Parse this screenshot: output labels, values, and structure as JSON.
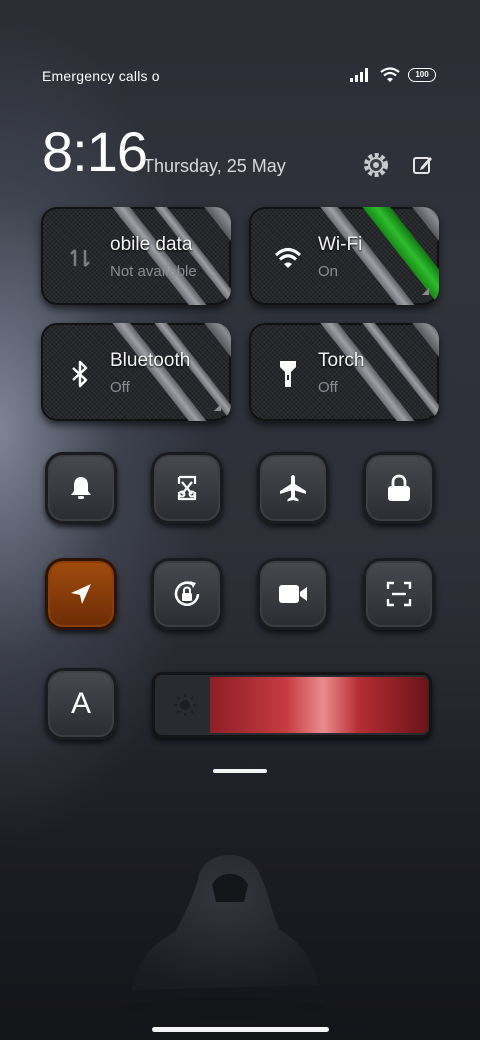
{
  "status_bar": {
    "carrier_text": "Emergency calls o",
    "battery_level": "100",
    "icons": [
      "signal-icon",
      "wifi-icon",
      "battery-icon"
    ]
  },
  "header": {
    "time": "8:16",
    "date": "Thursday, 25 May",
    "icons": [
      "settings-gear-icon",
      "edit-icon"
    ]
  },
  "large_tiles": [
    {
      "label": "obile data",
      "sub": "Not available",
      "icon": "mobile-data-icon",
      "accent": "#8a8b90"
    },
    {
      "label": "Wi-Fi",
      "sub": "On",
      "icon": "wifi-icon",
      "accent": "#1fa21f"
    },
    {
      "label": "Bluetooth",
      "sub": "Off",
      "icon": "bluetooth-icon",
      "accent": "#8a8b90"
    },
    {
      "label": "Torch",
      "sub": "Off",
      "icon": "torch-icon",
      "accent": "#8a8b90"
    }
  ],
  "small_toggles": [
    {
      "icon": "bell-icon",
      "active": false
    },
    {
      "icon": "screenshot-icon",
      "active": false
    },
    {
      "icon": "airplane-icon",
      "active": false
    },
    {
      "icon": "lock-icon",
      "active": false
    },
    {
      "icon": "location-icon",
      "active": true,
      "accent": "#a44d0e"
    },
    {
      "icon": "rotation-lock-icon",
      "active": false
    },
    {
      "icon": "video-camera-icon",
      "active": false
    },
    {
      "icon": "scan-icon",
      "active": false
    }
  ],
  "bottom_row": {
    "auto_brightness_label": "A",
    "brightness_level": 0.79,
    "brightness_color": "#c63b40"
  }
}
